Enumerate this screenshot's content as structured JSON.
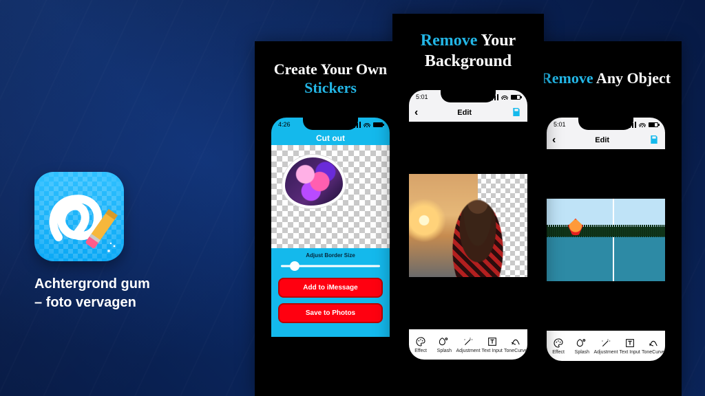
{
  "app": {
    "name": "Achtergrond gum",
    "subtitle": "– foto vervagen"
  },
  "cards": {
    "one": {
      "headline_pre": "Create Your Own ",
      "headline_hi": "Stickers",
      "time": "4:26",
      "screen_title": "Cut out",
      "slider_label": "Adjust Border Size",
      "btn_imessage": "Add to iMessage",
      "btn_save": "Save to Photos"
    },
    "two": {
      "headline_hi": "Remove",
      "headline_post": " Your Background",
      "time": "5:01",
      "screen_title": "Edit"
    },
    "three": {
      "headline_hi": "Remove",
      "headline_post": " Any Object",
      "time": "5:01",
      "screen_title": "Edit"
    }
  },
  "tools": [
    {
      "id": "effect",
      "label": "Effect"
    },
    {
      "id": "splash",
      "label": "Splash"
    },
    {
      "id": "adjustment",
      "label": "Adjustment"
    },
    {
      "id": "textinput",
      "label": "Text Input"
    },
    {
      "id": "tonecurve",
      "label": "ToneCurve"
    }
  ]
}
